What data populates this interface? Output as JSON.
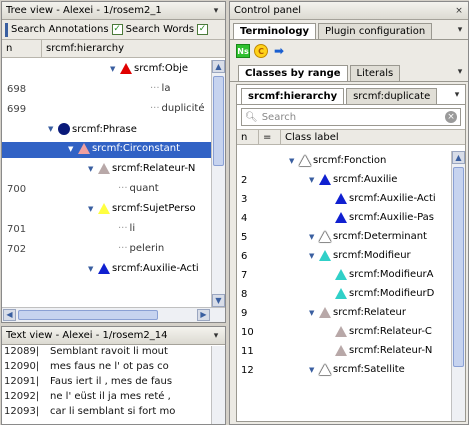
{
  "tree_view": {
    "title": "Tree view - Alexei - 1/rosem2_1",
    "search_annotations_label": "Search Annotations",
    "search_words_label": "Search Words",
    "col_n": "n",
    "col_hierarchy": "srcmf:hierarchy",
    "rows": [
      {
        "num": "",
        "label": "srcmf:Obje",
        "color": "#e00000",
        "kind": "triangle"
      },
      {
        "num": "698",
        "label": "la",
        "kind": "leaf"
      },
      {
        "num": "699",
        "label": "duplicité",
        "kind": "leaf"
      },
      {
        "num": "",
        "label": "srcmf:Phrase",
        "color": "#0a1a7a",
        "kind": "dot"
      },
      {
        "num": "",
        "label": "srcmf:Circonstant",
        "color": "#f0a0a0",
        "kind": "triangle",
        "selected": true
      },
      {
        "num": "",
        "label": "srcmf:Relateur-N",
        "color": "#b8a8a8",
        "kind": "triangle"
      },
      {
        "num": "700",
        "label": "quant",
        "kind": "leaf"
      },
      {
        "num": "",
        "label": "srcmf:SujetPerso",
        "color": "#ffff40",
        "kind": "triangle"
      },
      {
        "num": "701",
        "label": "li",
        "kind": "leaf"
      },
      {
        "num": "702",
        "label": "pelerin",
        "kind": "leaf"
      },
      {
        "num": "",
        "label": "srcmf:Auxilie-Acti",
        "color": "#1020d0",
        "kind": "triangle"
      }
    ]
  },
  "text_view": {
    "title": "Text view - Alexei - 1/rosem2_14",
    "lines": [
      {
        "num": "12089|",
        "text": "Semblant ravoit li mout"
      },
      {
        "num": "12090|",
        "text": "mes faus ne l' ot pas co"
      },
      {
        "num": "12091|",
        "text": "Faus iert il , mes de faus"
      },
      {
        "num": "12092|",
        "text": "ne l' eüst il ja mes reté ,"
      },
      {
        "num": "12093|",
        "text": "car li semblant si fort mo"
      }
    ]
  },
  "control_panel": {
    "title": "Control panel",
    "tabs": [
      "Terminology",
      "Plugin configuration"
    ],
    "toolbar_icons": [
      "ns-icon",
      "c-icon",
      "arrow-icon"
    ],
    "ns_text": "Ns",
    "c_text": "C",
    "sub_tabs": [
      "Classes by range",
      "Literals"
    ],
    "hier_tabs": [
      "srcmf:hierarchy",
      "srcmf:duplicate"
    ],
    "search_placeholder": "Search",
    "col_n": "n",
    "col_eq": "=",
    "col_label": "Class label",
    "classes": [
      {
        "num": "",
        "label": "srcmf:Fonction",
        "color": "#ffffff",
        "level": 0
      },
      {
        "num": "2",
        "label": "srcmf:Auxilie",
        "color": "#1020d0",
        "level": 1
      },
      {
        "num": "3",
        "label": "srcmf:Auxilie-Acti",
        "color": "#1020d0",
        "level": 2
      },
      {
        "num": "4",
        "label": "srcmf:Auxilie-Pas",
        "color": "#1020d0",
        "level": 2
      },
      {
        "num": "5",
        "label": "srcmf:Determinant",
        "color": "#ffffff",
        "level": 1
      },
      {
        "num": "6",
        "label": "srcmf:Modifieur",
        "color": "#30d0c8",
        "level": 1
      },
      {
        "num": "7",
        "label": "srcmf:ModifieurA",
        "color": "#30d0c8",
        "level": 2
      },
      {
        "num": "8",
        "label": "srcmf:ModifieurD",
        "color": "#30d0c8",
        "level": 2
      },
      {
        "num": "9",
        "label": "srcmf:Relateur",
        "color": "#b8a8a8",
        "level": 1
      },
      {
        "num": "10",
        "label": "srcmf:Relateur-C",
        "color": "#b8a8a8",
        "level": 2
      },
      {
        "num": "11",
        "label": "srcmf:Relateur-N",
        "color": "#b8a8a8",
        "level": 2
      },
      {
        "num": "12",
        "label": "srcmf:Satellite",
        "color": "#ffffff",
        "level": 1
      }
    ]
  }
}
